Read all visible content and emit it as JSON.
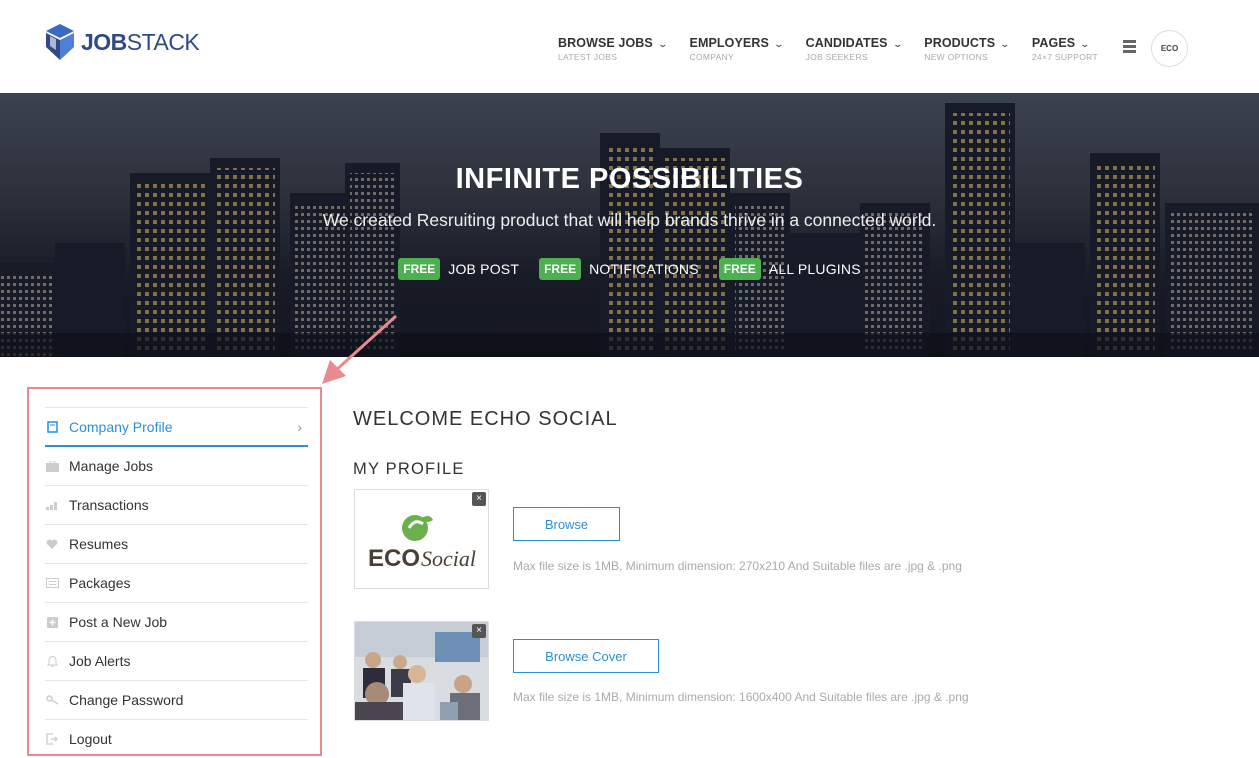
{
  "header": {
    "logo_job": "JOB",
    "logo_stack": "STACK",
    "nav": [
      {
        "label": "BROWSE JOBS",
        "sub": "LATEST JOBS"
      },
      {
        "label": "EMPLOYERS",
        "sub": "COMPANY"
      },
      {
        "label": "CANDIDATES",
        "sub": "JOB SEEKERS"
      },
      {
        "label": "PRODUCTS",
        "sub": "NEW OPTIONS"
      },
      {
        "label": "PAGES",
        "sub": "24×7 SUPPORT"
      }
    ],
    "avatar_text": "ECO"
  },
  "hero": {
    "title": "INFINITE  POSSIBILITIES",
    "subtitle": "We created Resruiting product that will help brands thrive in a connected world.",
    "tags": [
      {
        "badge": "FREE",
        "label": "JOB POST"
      },
      {
        "badge": "FREE",
        "label": "NOTIFICATIONS"
      },
      {
        "badge": "FREE",
        "label": "ALL PLUGINS"
      }
    ]
  },
  "sidebar": {
    "items": [
      {
        "label": "Company Profile",
        "icon": "profile-icon",
        "active": true
      },
      {
        "label": "Manage Jobs",
        "icon": "briefcase-icon"
      },
      {
        "label": "Transactions",
        "icon": "chart-icon"
      },
      {
        "label": "Resumes",
        "icon": "heart-icon"
      },
      {
        "label": "Packages",
        "icon": "package-icon"
      },
      {
        "label": "Post a New Job",
        "icon": "plus-icon"
      },
      {
        "label": "Job Alerts",
        "icon": "bell-icon"
      },
      {
        "label": "Change Password",
        "icon": "key-icon"
      },
      {
        "label": "Logout",
        "icon": "logout-icon"
      }
    ]
  },
  "main": {
    "welcome": "WELCOME ECHO SOCIAL",
    "profile_heading": "MY PROFILE",
    "logo_thumb_text_eco": "ECO",
    "logo_thumb_text_social": "Social",
    "browse_label": "Browse",
    "browse_hint": "Max file size is 1MB, Minimum dimension: 270x210 And Suitable files are .jpg & .png",
    "browse_cover_label": "Browse Cover",
    "cover_hint": "Max file size is 1MB, Minimum dimension: 1600x400 And Suitable files are .jpg & .png",
    "close_glyph": "×"
  },
  "colors": {
    "accent": "#2d8fd5",
    "badge_green": "#4caf50",
    "annotation": "#e88a8e",
    "logo_blue": "#2f4a8a"
  }
}
